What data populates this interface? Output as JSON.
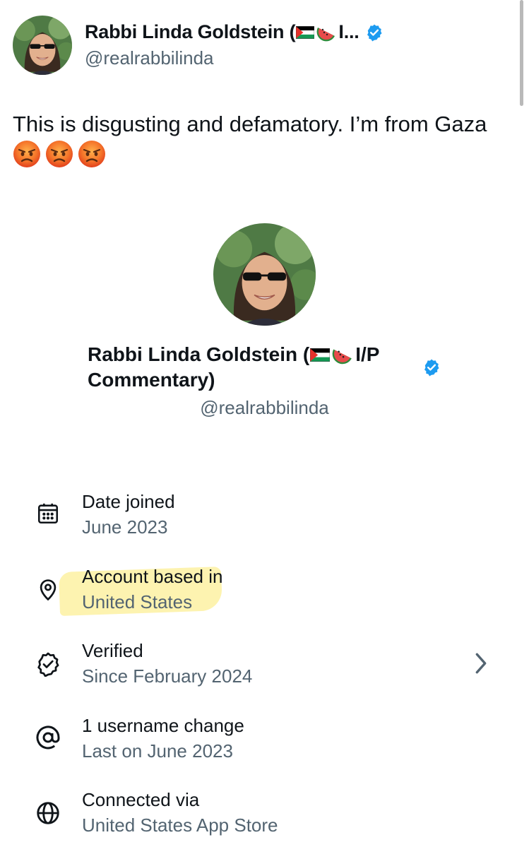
{
  "tweet": {
    "display_name": "Rabbi Linda Goldstein (",
    "display_name_tail": "I...",
    "handle": "@realrabbilinda",
    "text": "This is disgusting and defamatory. I’m from Gaza",
    "emojis": [
      "angry-face",
      "angry-face",
      "angry-face"
    ]
  },
  "profile": {
    "name_line1_start": "Rabbi Linda Goldstein (",
    "name_line1_end": "I/P",
    "name_line2": "Commentary)",
    "handle": "@realrabbilinda"
  },
  "about": [
    {
      "icon": "calendar-icon",
      "title": "Date joined",
      "value": "June 2023"
    },
    {
      "icon": "location-pin-icon",
      "title": "Account based in",
      "value": "United States",
      "highlighted": true
    },
    {
      "icon": "verified-badge-icon",
      "title": "Verified",
      "value": "Since February 2024",
      "has_chevron": true
    },
    {
      "icon": "at-sign-icon",
      "title": "1 username change",
      "value": "Last on June 2023"
    },
    {
      "icon": "globe-icon",
      "title": "Connected via",
      "value": "United States App Store"
    }
  ],
  "colors": {
    "verified": "#1d9bf0",
    "muted_text": "#536471",
    "highlight": "#fdf1a2"
  }
}
